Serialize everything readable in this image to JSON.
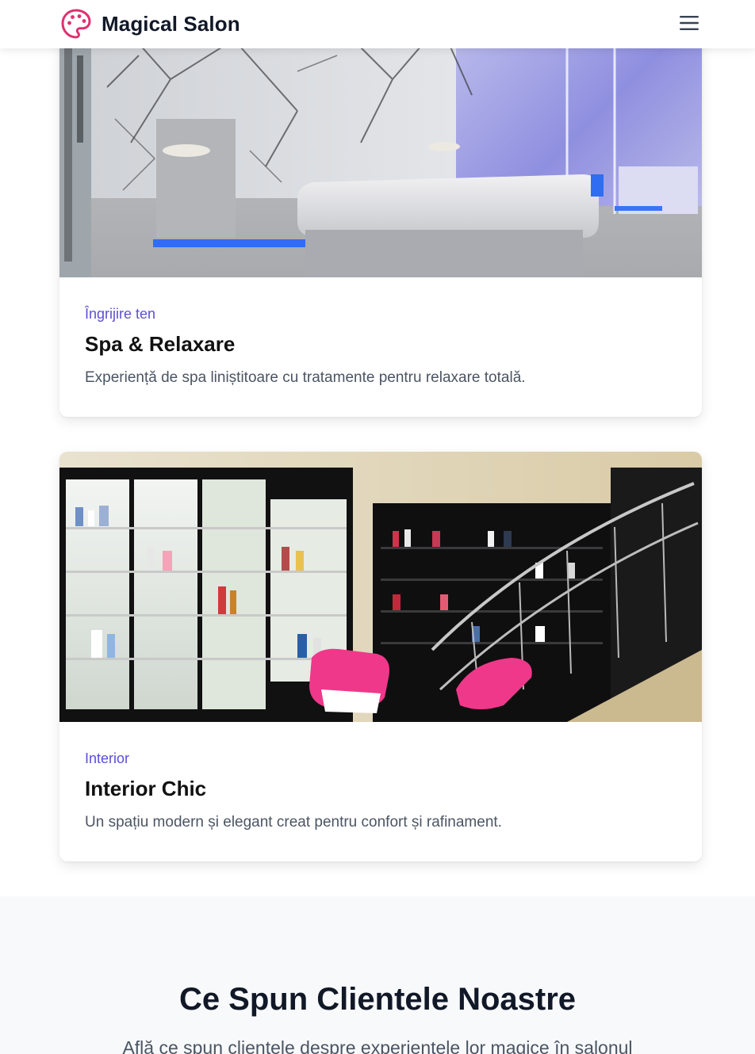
{
  "header": {
    "brand_name": "Magical Salon",
    "logo_icon": "palette-icon",
    "menu_icon": "hamburger-menu-icon",
    "brand_color": "#e0306f"
  },
  "cards": [
    {
      "category": "Îngrijire ten",
      "title": "Spa & Relaxare",
      "description": "Experiență de spa liniștitoare cu tratamente pentru relaxare totală."
    },
    {
      "category": "Interior",
      "title": "Interior Chic",
      "description": "Un spațiu modern și elegant creat pentru confort și rafinament."
    }
  ],
  "testimonials": {
    "title": "Ce Spun Clientele Noastre",
    "subtitle": "Află ce spun clientele despre experiențele lor magice în salonul"
  },
  "colors": {
    "accent": "#5b4fd6",
    "text": "#111827",
    "muted": "#4b5563",
    "section_bg": "#f8f9fb"
  }
}
